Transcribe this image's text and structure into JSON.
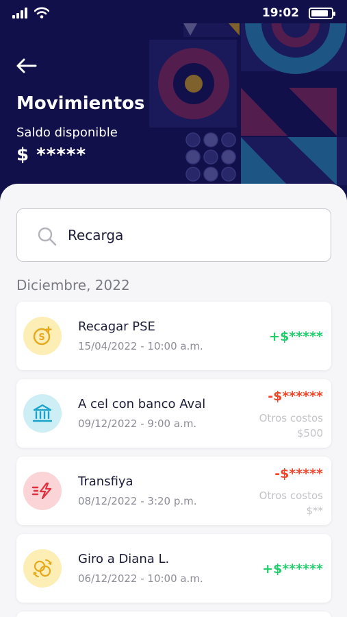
{
  "status_bar": {
    "time": "19:02",
    "battery_level": 0.85
  },
  "header": {
    "title": "Movimientos",
    "balance_label": "Saldo disponible",
    "balance_value": "$ *****"
  },
  "search": {
    "value": "Recarga",
    "placeholder": ""
  },
  "section": {
    "title": "Diciembre, 2022"
  },
  "transactions": [
    {
      "name": "Recagar PSE",
      "date": "15/04/2022 - 10:00 a.m.",
      "amount": "+$*****",
      "direction": "in",
      "icon": "coin-plus-icon",
      "extra_label": "",
      "extra_value": ""
    },
    {
      "name": "A cel con banco Aval",
      "date": "09/12/2022 - 9:00 a.m.",
      "amount": "-$******",
      "direction": "out",
      "icon": "bank-icon",
      "extra_label": "Otros costos",
      "extra_value": "$500"
    },
    {
      "name": "Transfiya",
      "date": "08/12/2022 - 3:20 p.m.",
      "amount": "-$*****",
      "direction": "out",
      "icon": "lightning-transfer-icon",
      "extra_label": "Otros costos",
      "extra_value": "$**"
    },
    {
      "name": "Giro a Diana L.",
      "date": "06/12/2022 - 10:00 a.m.",
      "amount": "+$******",
      "direction": "in",
      "icon": "coins-exchange-icon",
      "extra_label": "",
      "extra_value": ""
    }
  ],
  "colors": {
    "header_bg": "#12104a",
    "positive": "#1fcf6c",
    "negative": "#f0462b",
    "icon_yellow_bg": "#fdeeb6",
    "icon_blue_bg": "#cdeef5",
    "icon_red_bg": "#fbd4d8"
  }
}
